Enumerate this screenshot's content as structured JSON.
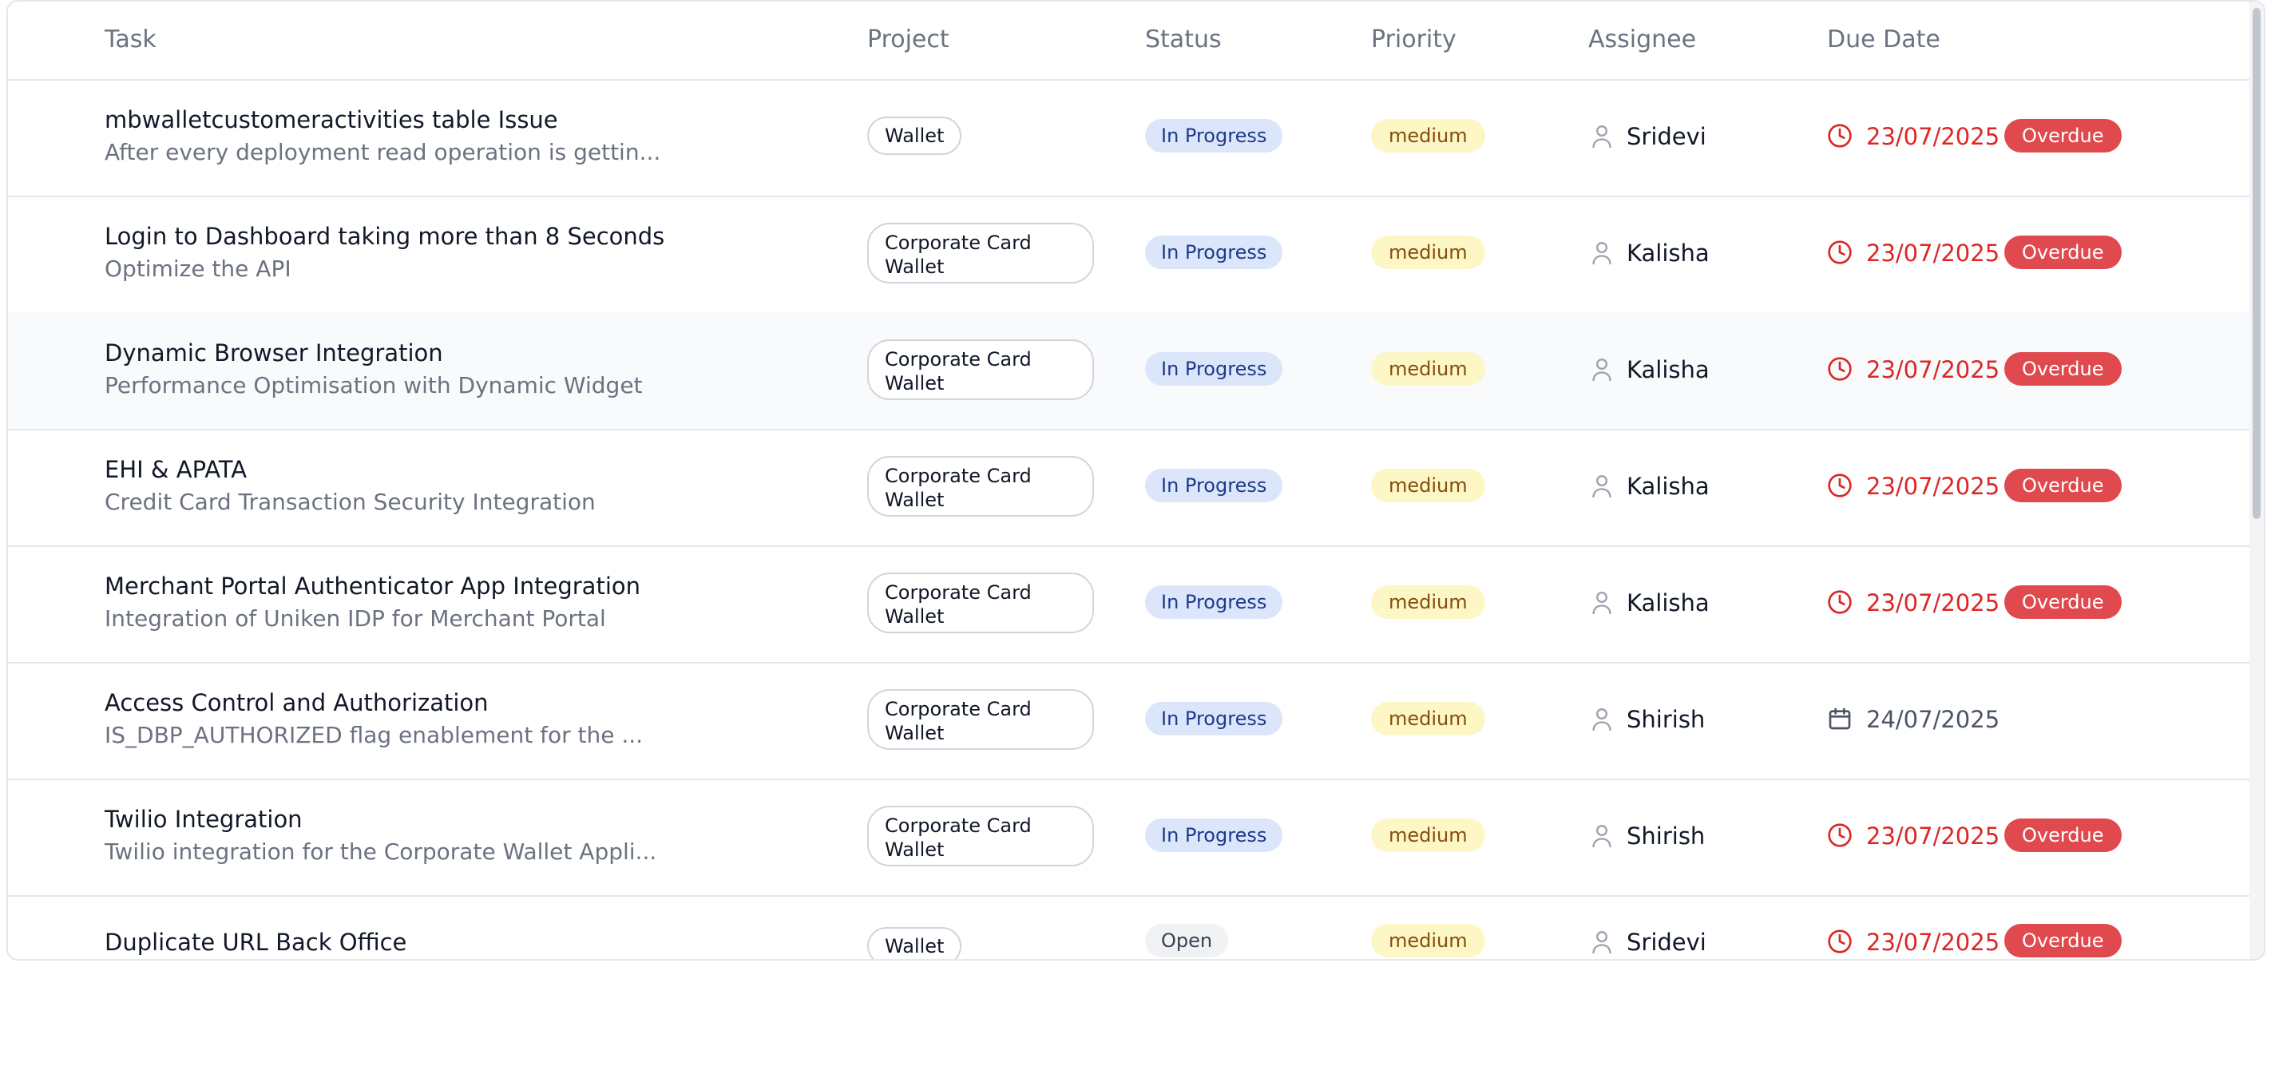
{
  "headers": {
    "task": "Task",
    "project": "Project",
    "status": "Status",
    "priority": "Priority",
    "assignee": "Assignee",
    "due_date": "Due Date"
  },
  "rows": [
    {
      "title": "mbwalletcustomeractivities table Issue",
      "desc": "After every deployment read operation is gettin...",
      "project": "Wallet",
      "status": "In Progress",
      "priority": "medium",
      "assignee": "Sridevi",
      "due": "23/07/2025",
      "overdue": "Overdue"
    },
    {
      "title": "Login to Dashboard taking more than 8 Seconds",
      "desc": "Optimize the API",
      "project_line1": "Corporate Card",
      "project_line2": "Wallet",
      "status": "In Progress",
      "priority": "medium",
      "assignee": "Kalisha",
      "due": "23/07/2025",
      "overdue": "Overdue"
    },
    {
      "title": "Dynamic Browser Integration",
      "desc": "Performance Optimisation with Dynamic Widget",
      "project_line1": "Corporate Card",
      "project_line2": "Wallet",
      "status": "In Progress",
      "priority": "medium",
      "assignee": "Kalisha",
      "due": "23/07/2025",
      "overdue": "Overdue"
    },
    {
      "title": "EHI & APATA",
      "desc": "Credit Card Transaction Security Integration",
      "project_line1": "Corporate Card",
      "project_line2": "Wallet",
      "status": "In Progress",
      "priority": "medium",
      "assignee": "Kalisha",
      "due": "23/07/2025",
      "overdue": "Overdue"
    },
    {
      "title": "Merchant Portal Authenticator App Integration",
      "desc": "Integration of Uniken IDP for Merchant Portal",
      "project_line1": "Corporate Card",
      "project_line2": "Wallet",
      "status": "In Progress",
      "priority": "medium",
      "assignee": "Kalisha",
      "due": "23/07/2025",
      "overdue": "Overdue"
    },
    {
      "title": "Access Control and Authorization",
      "desc": "IS_DBP_AUTHORIZED flag enablement for the ...",
      "project_line1": "Corporate Card",
      "project_line2": "Wallet",
      "status": "In Progress",
      "priority": "medium",
      "assignee": "Shirish",
      "due": "24/07/2025"
    },
    {
      "title": "Twilio Integration",
      "desc": "Twilio integration for the Corporate Wallet Appli...",
      "project_line1": "Corporate Card",
      "project_line2": "Wallet",
      "status": "In Progress",
      "priority": "medium",
      "assignee": "Shirish",
      "due": "23/07/2025",
      "overdue": "Overdue"
    },
    {
      "title": "Duplicate URL Back Office",
      "project": "Wallet",
      "status": "Open",
      "priority": "medium",
      "assignee": "Sridevi",
      "due": "23/07/2025",
      "overdue": "Overdue"
    }
  ],
  "icons": {
    "assignee": "user-icon",
    "due_overdue": "clock-icon",
    "due_upcoming": "calendar-icon"
  },
  "colors": {
    "overdue": "#e0494d",
    "due_overdue_text": "#dc2626",
    "in_progress_bg": "#dbe6fb",
    "medium_bg": "#fdf6c5"
  }
}
